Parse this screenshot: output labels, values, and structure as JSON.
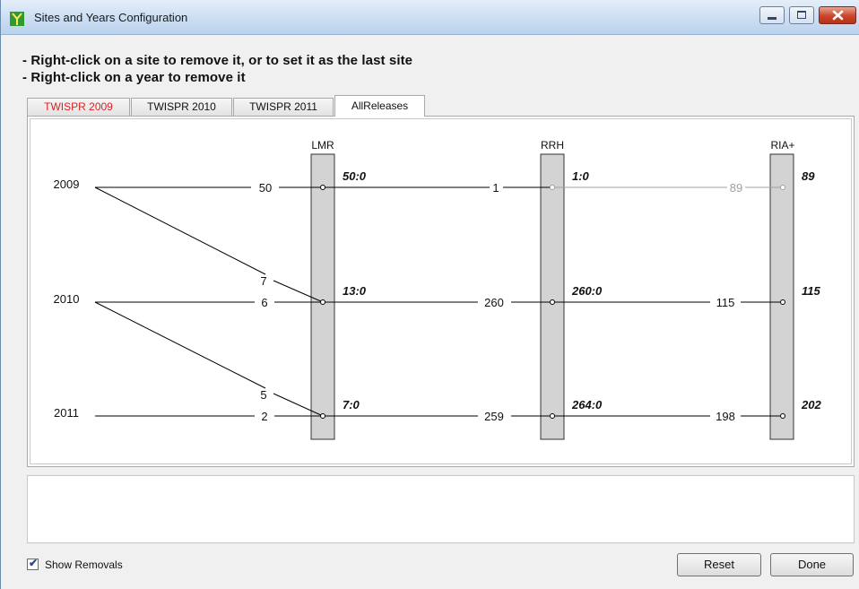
{
  "window": {
    "title": "Sites and Years Configuration",
    "controls": {
      "minimize": "minimize",
      "maximize": "maximize",
      "close": "close"
    }
  },
  "instructions": [
    "- Right-click on a site to remove it, or to set it as the last site",
    "- Right-click on a year to remove it"
  ],
  "tabs": [
    {
      "label": "TWISPR 2009",
      "color": "#e02020"
    },
    {
      "label": "TWISPR 2010",
      "color": "#111111"
    },
    {
      "label": "TWISPR 2011",
      "color": "#111111"
    },
    {
      "label": "AllReleases",
      "color": "#111111",
      "active": true
    }
  ],
  "graph": {
    "sites": [
      "LMR",
      "RRH",
      "RIA+"
    ],
    "years": [
      "2009",
      "2010",
      "2011"
    ],
    "year_to_first_site": [
      {
        "year": "2009",
        "count": "50"
      },
      {
        "year": "2010",
        "count": "6"
      },
      {
        "year": "2011",
        "count": "2"
      }
    ],
    "cross_links": [
      {
        "from": "2009",
        "to": "2010",
        "count": "7"
      },
      {
        "from": "2010",
        "to": "2011",
        "count": "5"
      }
    ],
    "site_rows": {
      "LMR": [
        "50:0",
        "13:0",
        "7:0"
      ],
      "RRH": [
        "1:0",
        "260:0",
        "264:0"
      ],
      "RIA+": [
        "89",
        "115",
        "202"
      ]
    },
    "segment_counts": {
      "LMR_to_RRH": [
        "1",
        "260",
        "259"
      ],
      "RRH_to_RIA+": [
        "89",
        "115",
        "198"
      ]
    },
    "grey_color": "#a0a0a0"
  },
  "footer": {
    "show_removals_label": "Show Removals",
    "show_removals_checked": true,
    "reset_label": "Reset",
    "done_label": "Done"
  }
}
